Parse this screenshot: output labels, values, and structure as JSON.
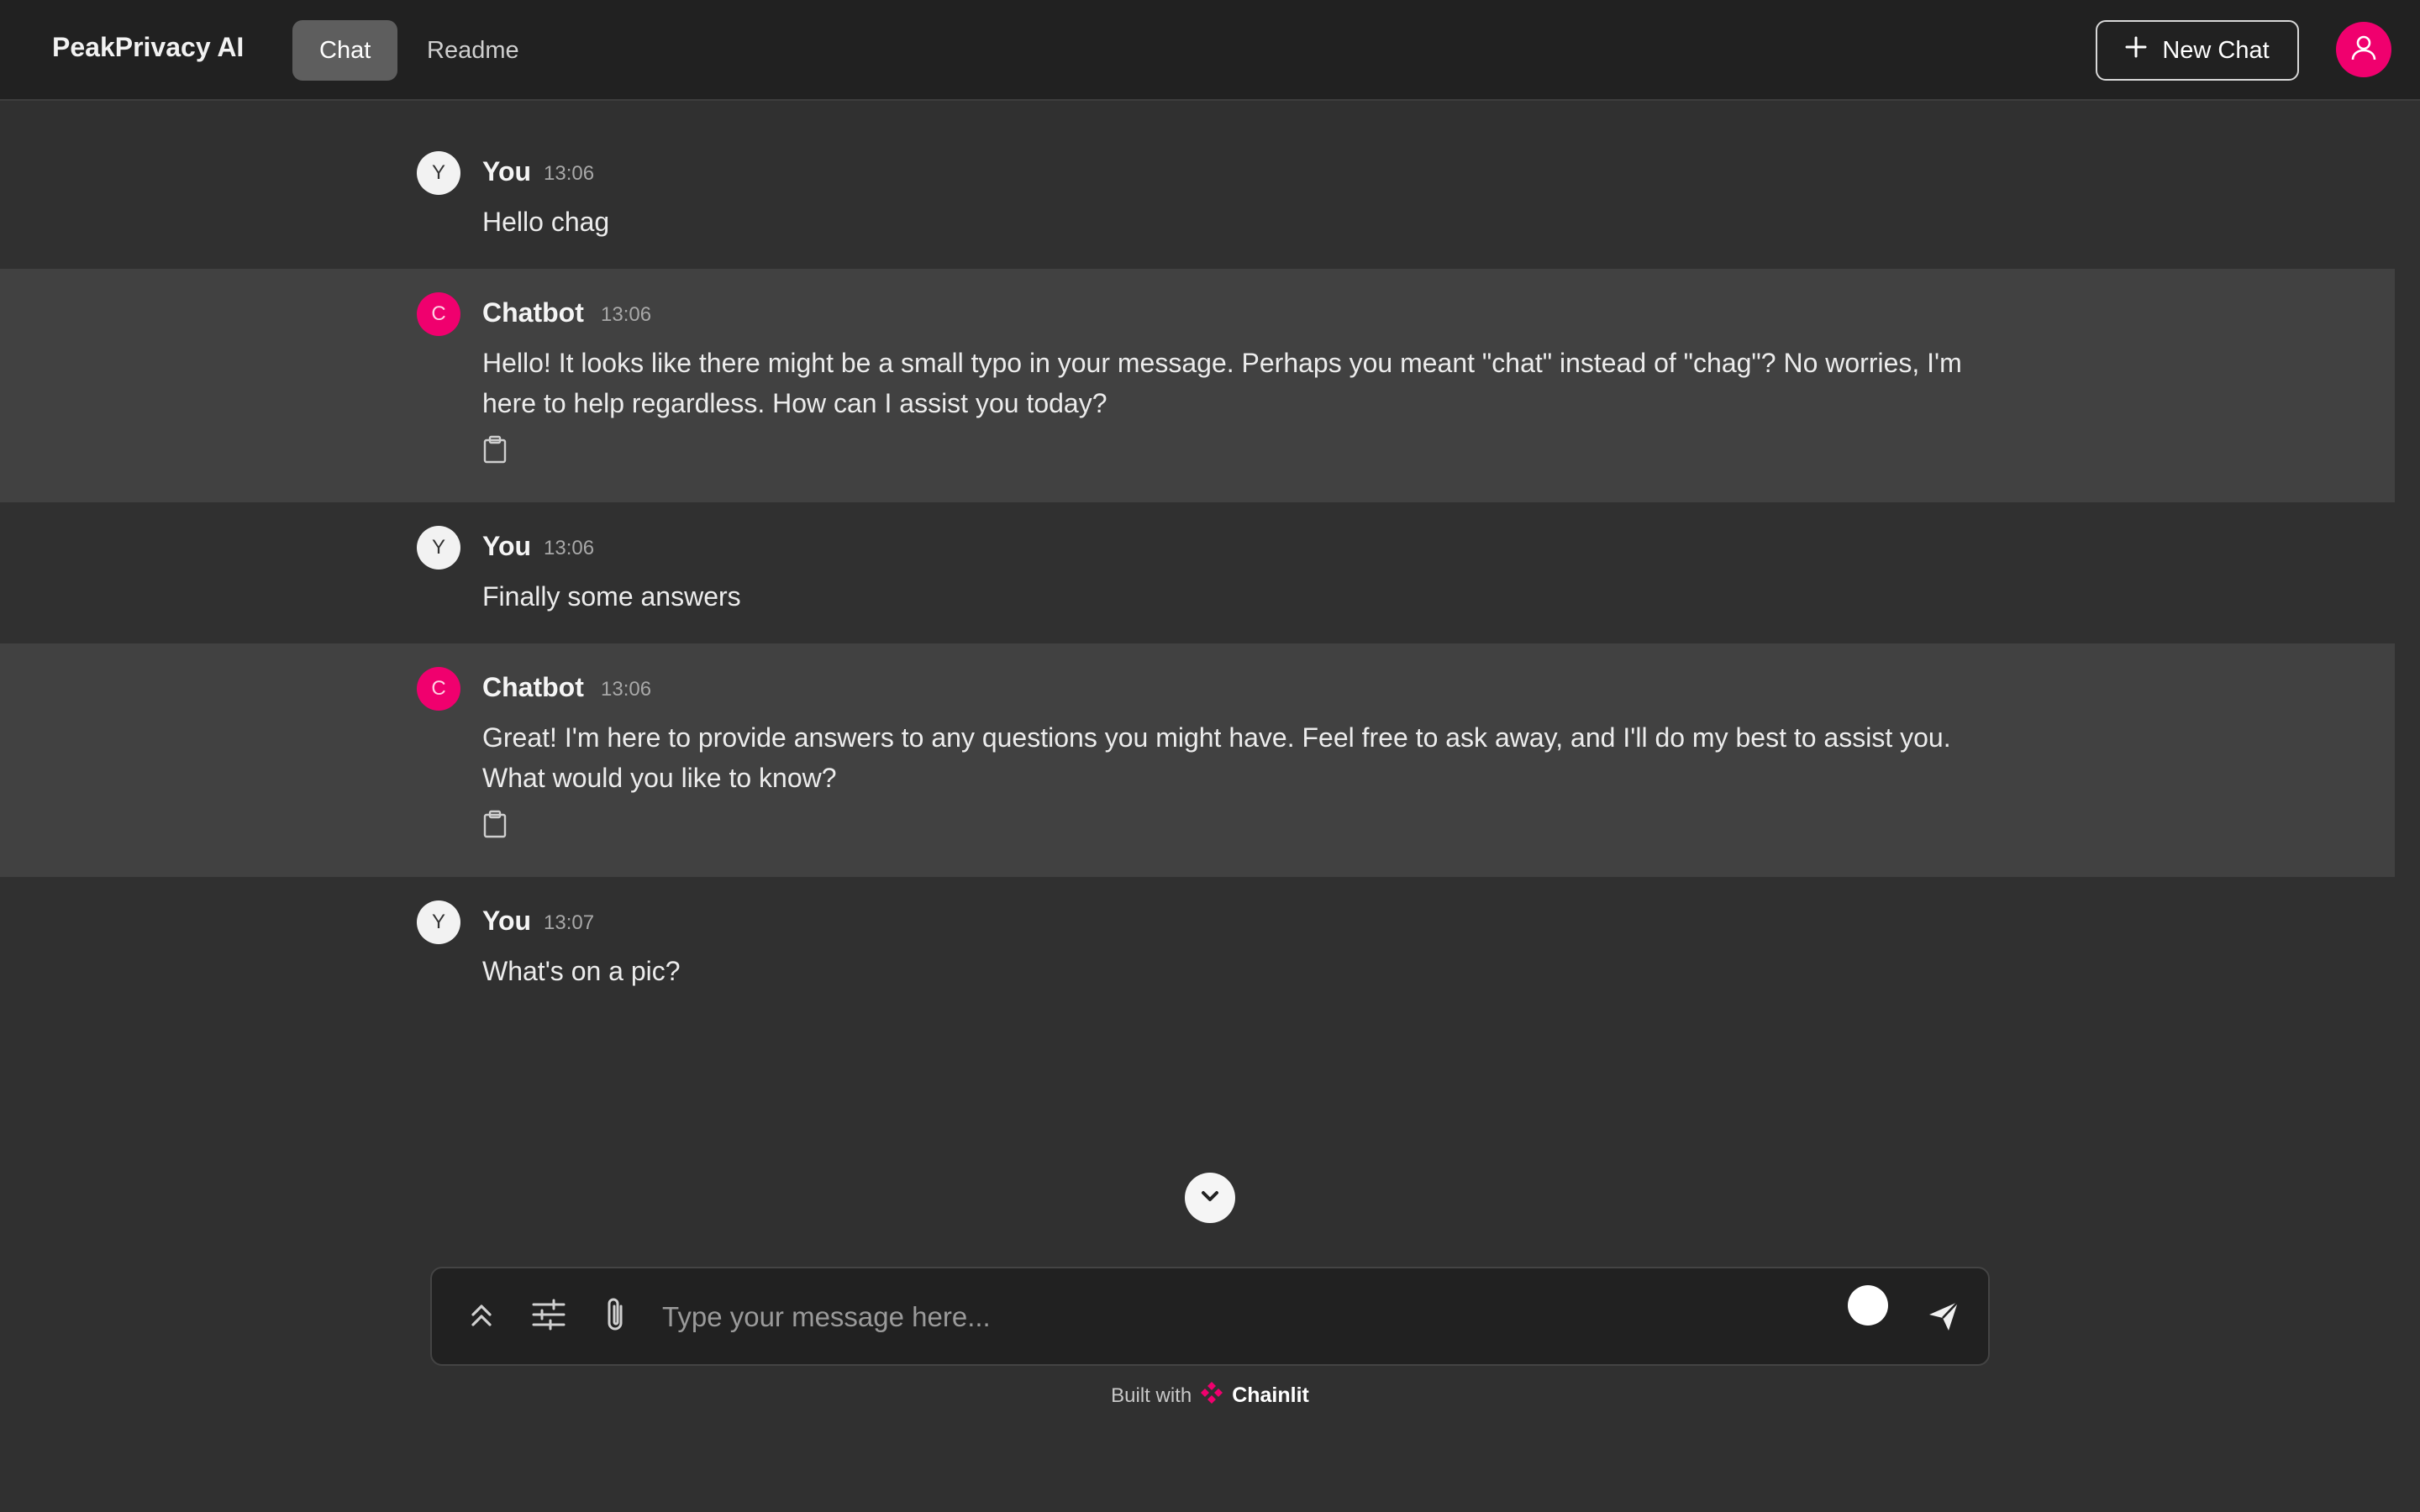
{
  "app": {
    "title": "PeakPrivacy AI"
  },
  "header": {
    "tabs": [
      {
        "label": "Chat",
        "active": true
      },
      {
        "label": "Readme",
        "active": false
      }
    ],
    "new_chat_label": "New Chat"
  },
  "messages": [
    {
      "author": "You",
      "avatar": "Y",
      "time": "13:06",
      "text": "Hello chag",
      "role": "user"
    },
    {
      "author": "Chatbot",
      "avatar": "C",
      "time": "13:06",
      "text": "Hello! It looks like there might be a small typo in your message. Perhaps you meant \"chat\" instead of \"chag\"? No worries, I'm here to help regardless. How can I assist you today?",
      "role": "bot"
    },
    {
      "author": "You",
      "avatar": "Y",
      "time": "13:06",
      "text": "Finally some answers",
      "role": "user"
    },
    {
      "author": "Chatbot",
      "avatar": "C",
      "time": "13:06",
      "text": "Great! I'm here to provide answers to any questions you might have. Feel free to ask away, and I'll do my best to assist you. What would you like to know?",
      "role": "bot"
    },
    {
      "author": "You",
      "avatar": "Y",
      "time": "13:07",
      "text": "What's on a pic?",
      "role": "user"
    }
  ],
  "composer": {
    "placeholder": "Type your message here..."
  },
  "footer": {
    "built_with": "Built with",
    "brand": "Chainlit"
  },
  "colors": {
    "accent": "#f0006e",
    "background": "#303030",
    "header": "#212121",
    "bot_row": "#414141"
  },
  "icons": [
    "plus-icon",
    "user-icon",
    "clipboard-icon",
    "chevron-down-icon",
    "chevrons-up-icon",
    "sliders-icon",
    "paperclip-icon",
    "send-icon",
    "chainlit-logo-icon"
  ]
}
